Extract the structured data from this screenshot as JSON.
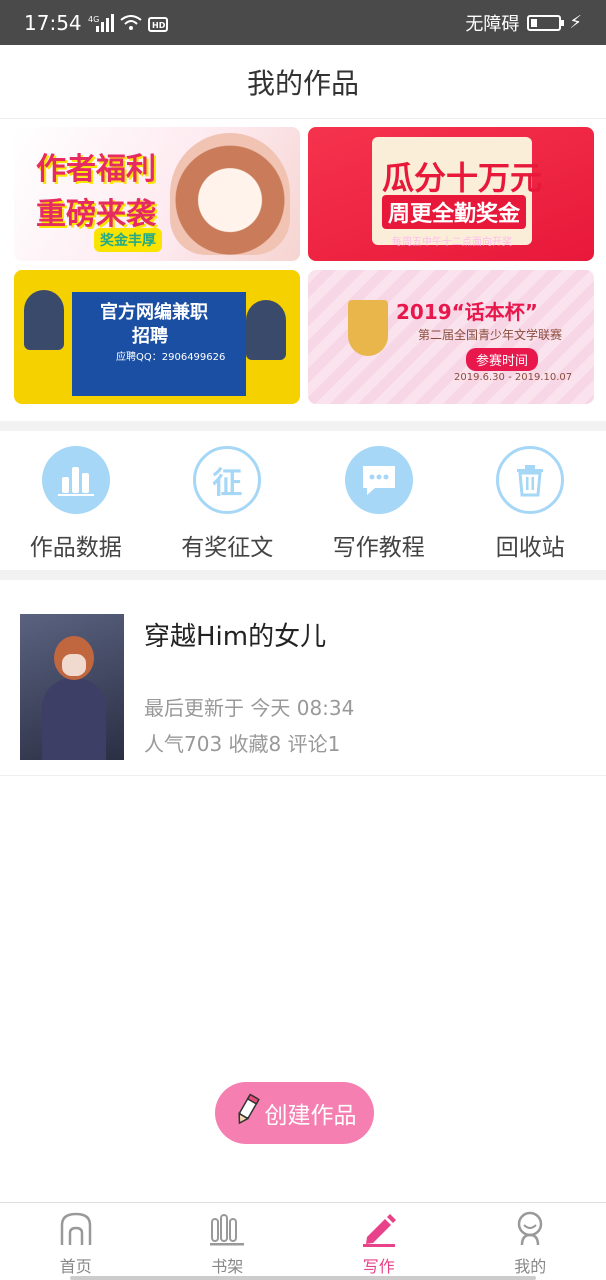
{
  "status": {
    "time": "17:54",
    "network": "4G",
    "hd": "HD",
    "accessibility": "无障碍"
  },
  "header": {
    "title": "我的作品"
  },
  "banners": [
    {
      "line1": "作者福利",
      "line2": "重磅来袭",
      "chip": "奖金丰厚"
    },
    {
      "line1": "瓜分十万元",
      "line2": "周更全勤奖金",
      "line3": "每周五中午十二点面向开奖"
    },
    {
      "line1": "官方网编兼职",
      "line2": "招聘",
      "line3": "应聘QQ：2906499626"
    },
    {
      "line1": "2019“话本杯”",
      "line2": "第二届全国青少年文学联赛",
      "line3": "参赛时间",
      "line4": "2019.6.30 - 2019.10.07"
    }
  ],
  "quick": [
    {
      "label": "作品数据",
      "icon": "bar-chart-icon"
    },
    {
      "label": "有奖征文",
      "icon": "zheng-icon",
      "glyph": "征"
    },
    {
      "label": "写作教程",
      "icon": "chat-bubble-icon"
    },
    {
      "label": "回收站",
      "icon": "trash-icon"
    }
  ],
  "work": {
    "title": "穿越Him的女儿",
    "updated": "最后更新于 今天 08:34",
    "stats": "人气703 收藏8 评论1"
  },
  "create_button": {
    "label": "创建作品"
  },
  "tabs": [
    {
      "label": "首页",
      "icon": "home-icon"
    },
    {
      "label": "书架",
      "icon": "bookshelf-icon"
    },
    {
      "label": "写作",
      "icon": "pencil-icon",
      "active": true
    },
    {
      "label": "我的",
      "icon": "profile-icon"
    }
  ],
  "colors": {
    "accent": "#e8438a",
    "quick_icon": "#a6d7f7",
    "create_bg": "#f57fb1"
  }
}
